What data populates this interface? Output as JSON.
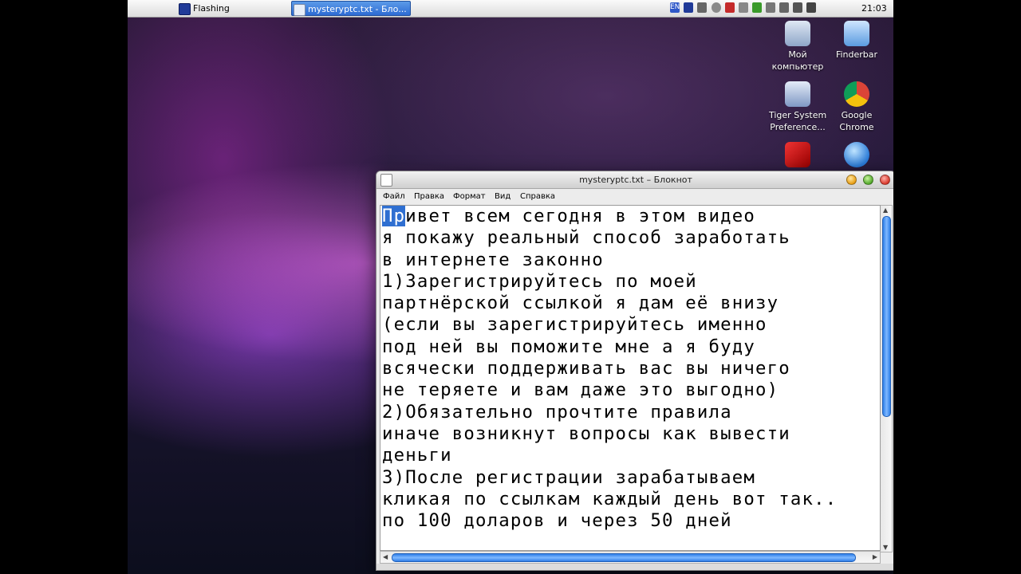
{
  "taskbar": {
    "apple_glyph": "",
    "tasks": [
      {
        "label": "Flashing"
      },
      {
        "label": "mysteryptc.txt - Бло..."
      }
    ],
    "tray_text": "EN",
    "clock": "21:03"
  },
  "desktop_icons": [
    {
      "label": "Мой\nкомпьютер",
      "icon": "computer-icon"
    },
    {
      "label": "Finderbar",
      "icon": "folder-icon"
    },
    {
      "label": "Tiger System\nPreference...",
      "icon": "preferences-icon"
    },
    {
      "label": "Google\nChrome",
      "icon": "chrome-icon"
    },
    {
      "label": "",
      "icon": "kaspersky-icon"
    },
    {
      "label": "",
      "icon": "itunes-icon"
    }
  ],
  "window": {
    "title": "mysteryptc.txt – Блокнот",
    "menu": [
      "Файл",
      "Правка",
      "Формат",
      "Вид",
      "Справка"
    ],
    "selected_text": "Пр",
    "text_rest": "ивет всем сегодня в этом видео\nя покажу реальный способ заработать\nв интернете законно\n1)Зарегистрируйтесь по моей\nпартнёрской ссылкой я дам её внизу\n(если вы зарегистрируйтесь именно\nпод ней вы поможите мне а я буду\nвсячески поддерживать вас вы ничего\nне теряете и вам даже это выгодно)\n2)Обязательно прочтите правила\nиначе возникнут вопросы как вывести\nденьги\n3)После регистрации зарабатываем\nкликая по ссылкам каждый день вот так..\nпо 100 доларов и через 50 дней"
  }
}
